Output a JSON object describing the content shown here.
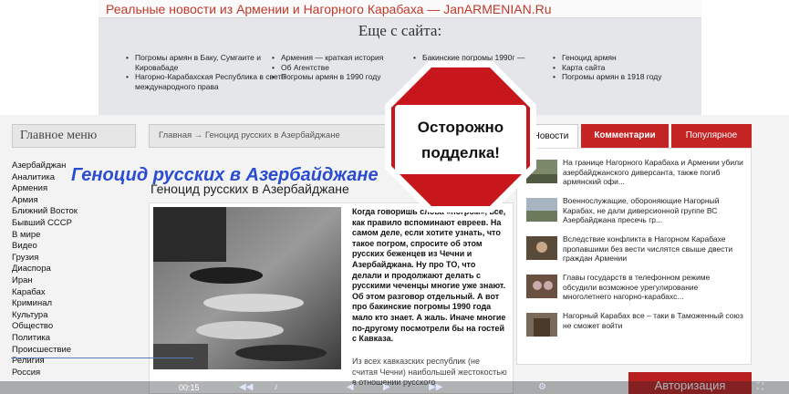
{
  "banner": {
    "text": "Реальные новости из Армении и Нагорного Карабаха — JanARMENIAN.Ru"
  },
  "more": {
    "title": "Еще с сайта:",
    "col1": [
      "Погромы армян в Баку, Сумгаите и Кировабаде",
      "Нагорно-Карабахская Республика в свете международного права"
    ],
    "col2": [
      "Армения — краткая история",
      "Об Агентстве",
      "Погромы армян в 1990 году"
    ],
    "col3": [
      "Бакинские погромы 1990г —"
    ],
    "col4": [
      "Геноцид армян",
      "Карта сайта",
      "Погромы армян в 1918 году"
    ]
  },
  "menu": {
    "title": "Главное меню",
    "items": [
      "Азербайджан",
      "Аналитика",
      "Армения",
      "Армия",
      "Ближний Восток",
      "Бывший СССР",
      "В мире",
      "Видео",
      "Грузия",
      "Диаспора",
      "Иран",
      "Карабах",
      "Криминал",
      "Культура",
      "Общество",
      "Политика",
      "Происшествие",
      "Религия",
      "Россия"
    ]
  },
  "breadcrumb": {
    "text": "Главная → Геноцид русских в Азербайджане"
  },
  "page_title": "Геноцид русских в Азербайджане",
  "article": {
    "title": "Геноцид русских в Азербайджане",
    "lead": "Когда говоришь слова «погром», все, как правило вспоминают евреев. На самом деле, если хотите узнать, что такое погром, спросите об этом русских беженцев из Чечни и Азербайджана. Ну про ТО, что делали и продолжают делать с русскими чеченцы многие уже знают. Об этом разговор отдельный. А вот про бакинские погромы 1990 года мало кто знает. А жаль. Иначе многие по-другому посмотрели бы на гостей с Кавказа.",
    "body": "Из всех кавказских республик (не считая Чечни) наибольшей жестокостью в отношении русского"
  },
  "stop_sign": {
    "line1": "Осторожно",
    "line2": "подделка!"
  },
  "tabs": {
    "news": "Новости",
    "comments": "Комментарии",
    "popular": "Популярное"
  },
  "news": [
    {
      "text": "На границе Нагорного Карабаха и Армении убили азербайджанского диверсанта, также погиб армянский офи..."
    },
    {
      "text": "Военнослужащие, обороняющие Нагорный Карабах, не дали диверсионной группе ВС Азербайджана пресечь гр..."
    },
    {
      "text": "Вследствие конфликта в Нагорном Карабахе пропавшими без вести числятся свыше двести граждан Армении"
    },
    {
      "text": "Главы государств в телефонном режиме обсудили возможное урегулирование многолетнего нагорно-карабахс..."
    },
    {
      "text": "Нагорный Карабах все – таки в Таможенный союз не сможет войти"
    }
  ],
  "auth_button": "Авторизация",
  "player": {
    "time": "00:15"
  },
  "colors": {
    "accent_red": "#c42424",
    "banner_red": "#c0392b",
    "title_blue": "#2a4cd0"
  }
}
